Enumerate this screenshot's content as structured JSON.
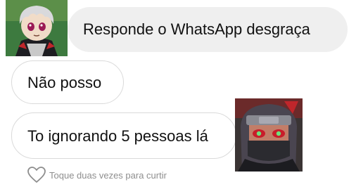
{
  "messages": [
    {
      "direction": "received",
      "text": "Responde o WhatsApp desgraça"
    },
    {
      "direction": "sent",
      "text": "Não posso"
    },
    {
      "direction": "sent",
      "text": "To ignorando 5 pessoas lá"
    }
  ],
  "footer": {
    "like_hint": "Toque duas vezes para curtir",
    "icon": "heart-outline-icon"
  },
  "avatars": [
    {
      "name": "avatar-hidan",
      "description_icon": "anime-avatar-icon"
    },
    {
      "name": "avatar-kakuzu",
      "description_icon": "anime-avatar-icon"
    }
  ],
  "colors": {
    "received_bubble_bg": "#efefef",
    "sent_bubble_border": "#dadada",
    "text": "#111111",
    "hint_text": "#8e8e8e"
  }
}
